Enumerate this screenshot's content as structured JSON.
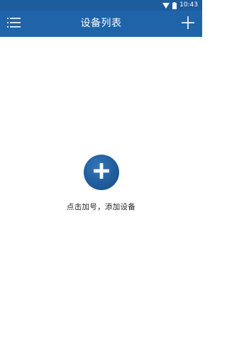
{
  "status_bar": {
    "time": "10:43",
    "icons": [
      "wifi-icon",
      "battery-icon"
    ]
  },
  "app_bar": {
    "title": "设备列表",
    "left_icon": "menu-icon",
    "right_icon": "plus-icon",
    "color": "#1f64a8"
  },
  "empty_state": {
    "hint": "点击加号，添加设备",
    "button_icon": "plus-icon",
    "button_color": "#1f5d9c"
  }
}
